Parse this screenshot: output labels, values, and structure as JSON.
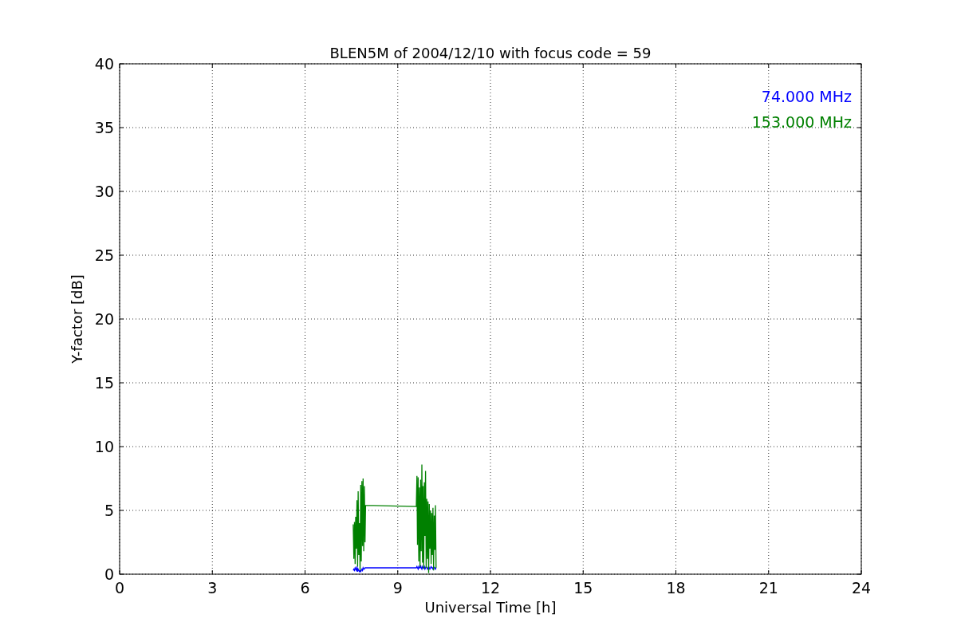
{
  "chart_data": {
    "type": "line",
    "title": "BLEN5M of 2004/12/10 with focus code = 59",
    "xlabel": "Universal Time [h]",
    "ylabel": "Y-factor [dB]",
    "x": [
      7.56,
      7.58,
      7.6,
      7.62,
      7.64,
      7.66,
      7.68,
      7.7,
      7.72,
      7.74,
      7.76,
      7.78,
      7.8,
      7.82,
      7.84,
      7.86,
      7.88,
      7.9,
      7.92,
      7.94,
      7.96,
      9.6,
      9.62,
      9.64,
      9.66,
      9.68,
      9.7,
      9.72,
      9.74,
      9.76,
      9.78,
      9.8,
      9.82,
      9.84,
      9.86,
      9.88,
      9.9,
      9.92,
      9.94,
      9.96,
      9.98,
      10.0,
      10.02,
      10.04,
      10.06,
      10.08,
      10.1,
      10.12,
      10.14,
      10.16,
      10.18,
      10.2,
      10.22,
      10.24
    ],
    "series": [
      {
        "name": "74.000 MHz",
        "color": "#0000ff",
        "values": [
          0.3,
          0.4,
          0.3,
          0.5,
          0.4,
          0.3,
          0.6,
          0.2,
          0.4,
          0.3,
          0.2,
          0.3,
          0.2,
          0.3,
          0.4,
          0.3,
          0.5,
          0.4,
          0.4,
          0.5,
          0.5,
          0.5,
          0.6,
          0.5,
          0.4,
          0.6,
          0.5,
          0.5,
          0.7,
          0.5,
          0.4,
          0.6,
          0.5,
          0.5,
          0.6,
          0.4,
          0.5,
          0.6,
          0.5,
          0.4,
          0.5,
          0.6,
          0.5,
          0.4,
          0.5,
          0.6,
          0.5,
          0.5,
          0.4,
          0.6,
          0.5,
          0.5,
          0.4,
          0.5
        ]
      },
      {
        "name": "153.000 MHz",
        "color": "#008000",
        "values": [
          3.9,
          1.2,
          4.1,
          0.8,
          4.5,
          2.0,
          5.8,
          0.6,
          6.5,
          1.5,
          4.0,
          0.3,
          7.0,
          1.0,
          7.3,
          2.2,
          7.5,
          1.8,
          6.9,
          2.5,
          5.4,
          5.3,
          7.7,
          2.3,
          7.6,
          1.0,
          6.8,
          0.6,
          7.4,
          1.8,
          8.6,
          0.9,
          6.9,
          0.4,
          7.2,
          3.0,
          8.1,
          0.5,
          5.9,
          1.2,
          5.7,
          0.1,
          5.5,
          2.0,
          5.0,
          0.8,
          4.8,
          1.5,
          5.2,
          0.3,
          4.6,
          1.9,
          5.4,
          0.5
        ]
      }
    ],
    "grid": true,
    "xlim": [
      0,
      24
    ],
    "ylim": [
      0,
      40
    ],
    "xticks": [
      0,
      3,
      6,
      9,
      12,
      15,
      18,
      21,
      24
    ],
    "yticks": [
      0,
      5,
      10,
      15,
      20,
      25,
      30,
      35,
      40
    ]
  }
}
